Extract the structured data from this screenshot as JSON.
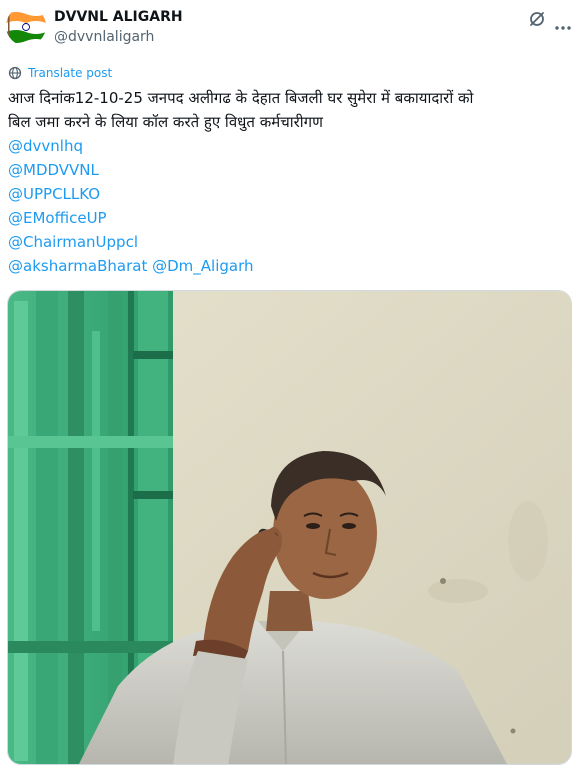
{
  "author": {
    "display_name": "DVVNL ALIGARH",
    "handle": "@dvvnlaligarh",
    "avatar_icon": "india-flag-avatar"
  },
  "header_icons": {
    "grok": "grok-icon",
    "more": "more-dots-icon"
  },
  "translate": {
    "label": "Translate post",
    "icon": "globe-icon"
  },
  "post": {
    "line1": "आज दिनांक12-10-25 जनपद अलीगढ के देहात बिजली घर सुमेरा में बकायादारों को",
    "line2": "बिल जमा करने के लिया कॉल करते हुए विधुत कर्मचारीगण",
    "mentions": [
      "@dvvnlhq",
      "@MDDVVNL",
      "@UPPCLLKO",
      "@EMofficeUP",
      "@ChairmanUppcl"
    ],
    "last_row": [
      "@aksharmaBharat",
      "@Dm_Aligarh"
    ]
  },
  "media": {
    "description_icon": "photo"
  },
  "colors": {
    "link": "#1d9bf0",
    "text": "#0f1419",
    "muted": "#536471",
    "saffron": "#ff9933",
    "green": "#138808",
    "chakra": "#000080"
  }
}
